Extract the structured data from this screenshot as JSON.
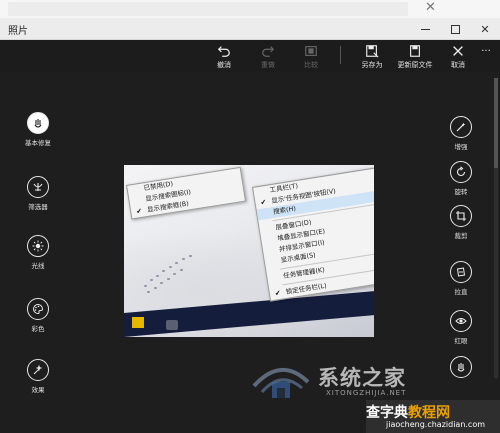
{
  "window": {
    "title": "照片",
    "min_label": "–",
    "max_label": "□",
    "close_label": "✕"
  },
  "desktop": {
    "close_label": "✕"
  },
  "toolbar": {
    "items": [
      {
        "label": "撤消",
        "icon": "undo-icon",
        "enabled": true
      },
      {
        "label": "重做",
        "icon": "redo-icon",
        "enabled": false
      },
      {
        "label": "比较",
        "icon": "compare-icon",
        "enabled": false
      },
      {
        "label": "另存为",
        "icon": "save-as-icon",
        "enabled": true
      },
      {
        "label": "更新原文件",
        "icon": "update-original-icon",
        "enabled": true
      },
      {
        "label": "取消",
        "icon": "close-icon",
        "enabled": true
      }
    ],
    "more_label": "···"
  },
  "left_tools": [
    {
      "label": "基本修复",
      "icon": "basic-fix-icon",
      "active": true
    },
    {
      "label": "筛选器",
      "icon": "filter-icon",
      "active": false
    },
    {
      "label": "光线",
      "icon": "light-icon",
      "active": false
    },
    {
      "label": "彩色",
      "icon": "color-icon",
      "active": false
    },
    {
      "label": "效果",
      "icon": "effects-icon",
      "active": false
    }
  ],
  "right_tools": [
    {
      "label": "增强",
      "icon": "enhance-icon"
    },
    {
      "label": "旋转",
      "icon": "rotate-icon"
    },
    {
      "label": "裁剪",
      "icon": "crop-icon"
    },
    {
      "label": "拉直",
      "icon": "straighten-icon"
    },
    {
      "label": "红眼",
      "icon": "red-eye-icon"
    },
    {
      "label": "",
      "icon": "retouch-icon"
    }
  ],
  "photo_menus": {
    "menu1": [
      {
        "label": "已禁用(D)",
        "checked": false
      },
      {
        "label": "显示搜索图标(I)",
        "checked": false
      },
      {
        "label": "显示搜索框(B)",
        "checked": true
      }
    ],
    "menu2": [
      {
        "label": "工具栏(T)",
        "checked": false,
        "sep_after": false
      },
      {
        "label": "显示'任务视图'按钮(V)",
        "checked": true,
        "sep_after": false
      },
      {
        "label": "搜索(H)",
        "checked": false,
        "highlight": true,
        "sep_after": true
      },
      {
        "label": "层叠窗口(D)",
        "checked": false,
        "sep_after": false
      },
      {
        "label": "堆叠显示窗口(E)",
        "checked": false,
        "sep_after": false
      },
      {
        "label": "并排显示窗口(I)",
        "checked": false,
        "sep_after": false
      },
      {
        "label": "显示桌面(S)",
        "checked": false,
        "sep_after": true
      },
      {
        "label": "任务管理器(K)",
        "checked": false,
        "sep_after": true
      },
      {
        "label": "锁定任务栏(L)",
        "checked": true,
        "sep_after": false
      }
    ]
  },
  "watermark": {
    "name": "系统之家",
    "sub": "XITONGZHIJIA.NET",
    "site_a": "查字典",
    "site_b": "教程网",
    "url": "jiaocheng.chazidian.com"
  },
  "colors": {
    "toolbar_bg": "#1c1c1c",
    "main_bg": "#1e1e1e",
    "titlebar_bg": "#ececec",
    "menu_highlight": "#cfe3f7",
    "taskbar": "#151d3d"
  }
}
